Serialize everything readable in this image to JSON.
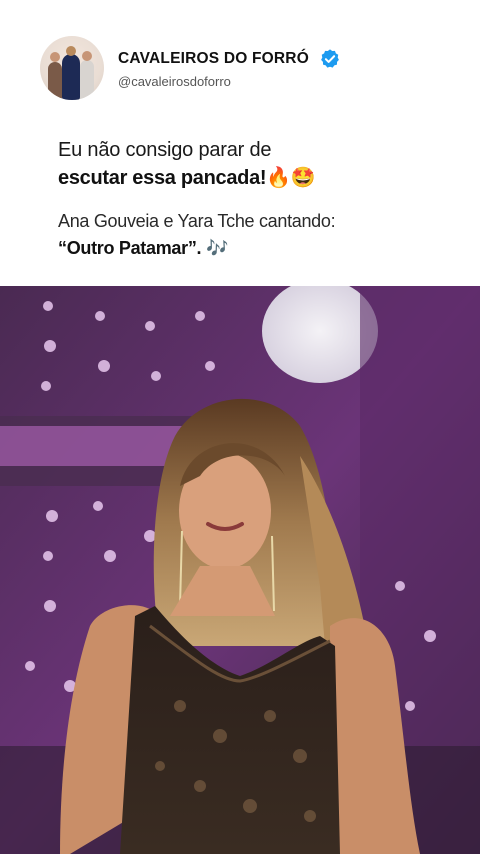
{
  "account": {
    "name": "CAVALEIROS DO FORRÓ",
    "handle": "@cavaleirosdoforro",
    "verified_color": "#1d9bf0"
  },
  "post": {
    "line1": "Eu não consigo parar de",
    "line2_text": "escutar essa pancada!",
    "line2_emoji": "🔥🤩",
    "line3": "Ana Gouveia e Yara Tche cantando:",
    "line4_text": "“Outro Patamar”.",
    "line4_emoji": "🎶"
  },
  "media": {
    "type": "video-frame",
    "stage_color": "#6a2f7a"
  }
}
